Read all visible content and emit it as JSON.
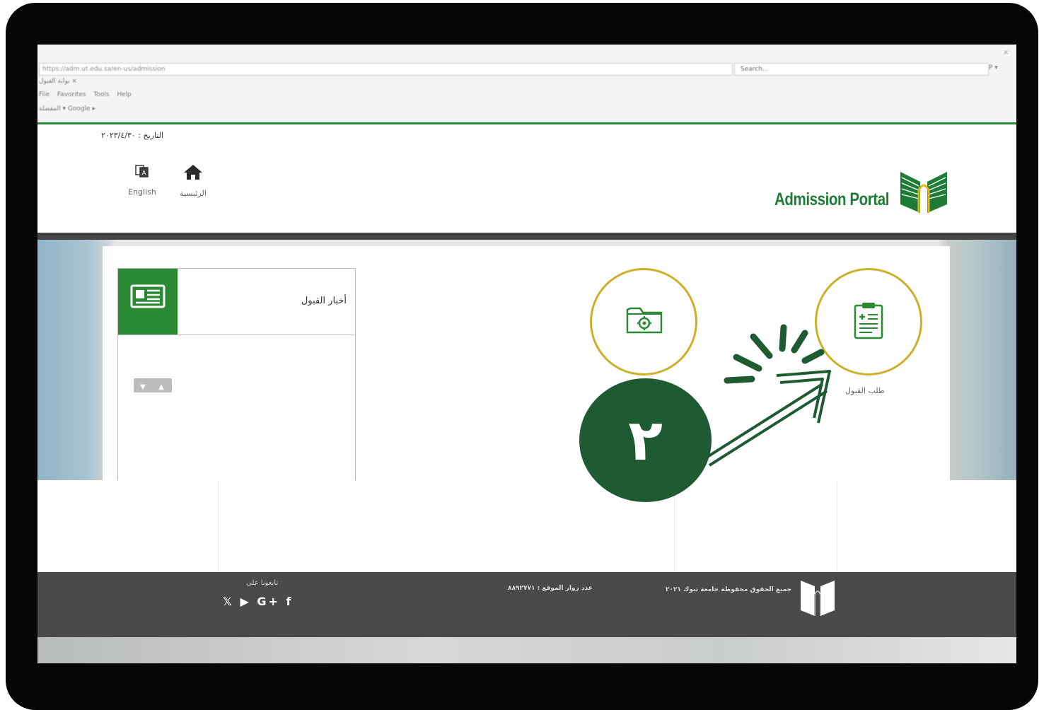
{
  "browser": {
    "address": "https://adm.ut.edu.sa/en-us/admission",
    "search_placeholder": "Search...",
    "zoom": "P ▾",
    "close": "×",
    "tab": "بوابة القبول  ×",
    "menu": "File  Favorites  Tools  Help",
    "favorites": "المفضلة  ▾  Google  ▸"
  },
  "header": {
    "date": "التاريخ : ٢٠٢٣/٤/٣٠",
    "nav": [
      {
        "label": "English",
        "icon": "language-icon"
      },
      {
        "label": "الرئيسية",
        "icon": "home-icon"
      }
    ],
    "logo_text": "Admission Portal",
    "brand_color": "#1e7c36"
  },
  "news": {
    "title": "أخبار القبول",
    "up": "▲",
    "down": "▼"
  },
  "services": {
    "apply_label": "طلب القبول",
    "step_number": "٢",
    "ring_color": "#cdb02a",
    "step_color": "#1e5a32"
  },
  "footer": {
    "follow_label": "تابعونا على",
    "social": "𝕏 ▶ G+ f",
    "visits": "عدد زوار الموقع : ٨٨٩٢٧٧١",
    "rights": "جميع الحقوق محفوظة جامعة تبوك ٢٠٢١"
  }
}
